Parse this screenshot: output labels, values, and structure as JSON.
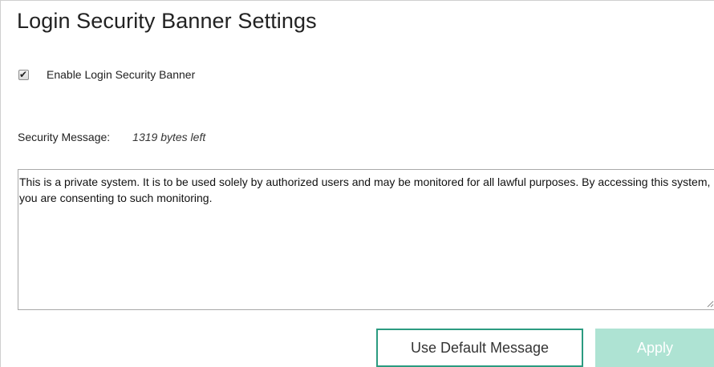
{
  "page": {
    "title": "Login Security Banner Settings"
  },
  "enable_banner": {
    "label": "Enable Login Security Banner",
    "checked": true
  },
  "security_message": {
    "label": "Security Message:",
    "bytes_left": "1319 bytes left",
    "text": "This is a private system. It is to be used solely by authorized users and may be monitored for all lawful purposes. By accessing this system, you are consenting to such monitoring."
  },
  "buttons": {
    "use_default": "Use Default Message",
    "apply": "Apply"
  },
  "colors": {
    "accent": "#2b9b80",
    "apply_disabled_bg": "#aee3d3"
  },
  "icons": {
    "checkbox": "check-icon",
    "resize": "resize-grip-icon"
  }
}
